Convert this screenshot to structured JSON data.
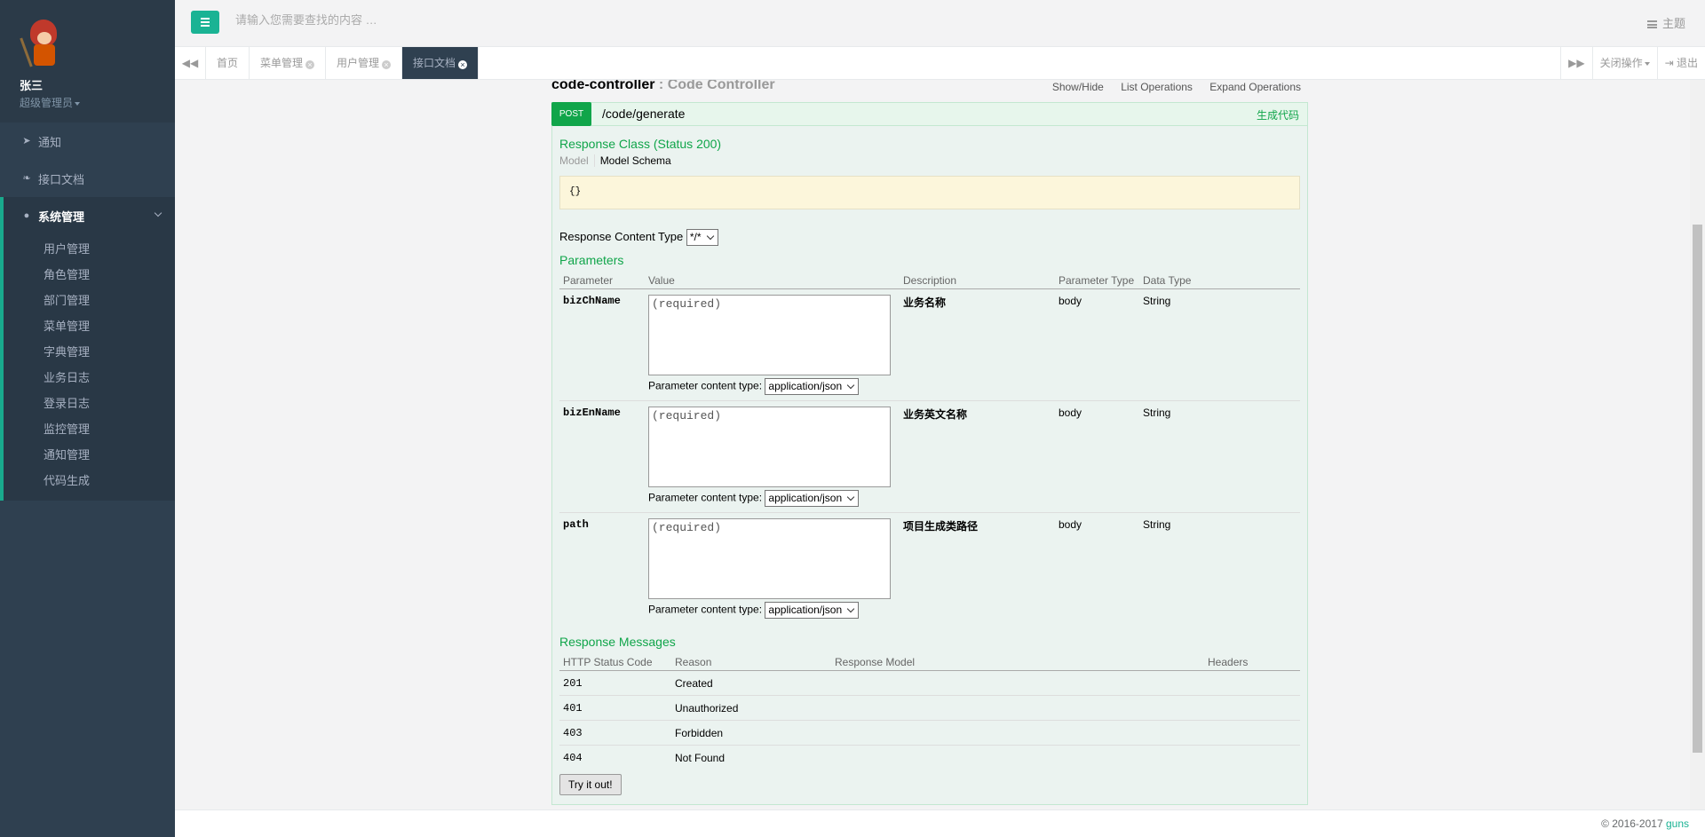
{
  "profile": {
    "name": "张三",
    "role": "超级管理员"
  },
  "nav": {
    "items": [
      {
        "label": "通知",
        "icon": "paper-plane-icon"
      },
      {
        "label": "接口文档",
        "icon": "leaf-icon"
      },
      {
        "label": "系统管理",
        "icon": "user-icon"
      }
    ],
    "sub_items": [
      "用户管理",
      "角色管理",
      "部门管理",
      "菜单管理",
      "字典管理",
      "业务日志",
      "登录日志",
      "监控管理",
      "通知管理",
      "代码生成"
    ]
  },
  "header": {
    "search_placeholder": "请输入您需要查找的内容 …",
    "theme_label": "主题"
  },
  "tabs": {
    "items": [
      "首页",
      "菜单管理",
      "用户管理",
      "接口文档"
    ],
    "active": "接口文档",
    "close_ops": "关闭操作",
    "logout": "退出"
  },
  "swagger": {
    "controller_name": "code-controller",
    "controller_sep": " : ",
    "controller_desc": "Code Controller",
    "links": [
      "Show/Hide",
      "List Operations",
      "Expand Operations"
    ],
    "op": {
      "method": "POST",
      "path": "/code/generate",
      "summary": "生成代码",
      "response_class_title": "Response Class (Status 200)",
      "model_tab": "Model",
      "schema_tab": "Model Schema",
      "model_value": "{}",
      "response_content_type_label": "Response Content Type",
      "response_content_type_value": "*/*",
      "parameters_title": "Parameters",
      "param_headers": [
        "Parameter",
        "Value",
        "Description",
        "Parameter Type",
        "Data Type"
      ],
      "params": [
        {
          "name": "bizChName",
          "placeholder": "(required)",
          "description": "业务名称",
          "ptype": "body",
          "dtype": "String",
          "content_type_label": "Parameter content type:",
          "content_type": "application/json"
        },
        {
          "name": "bizEnName",
          "placeholder": "(required)",
          "description": "业务英文名称",
          "ptype": "body",
          "dtype": "String",
          "content_type_label": "Parameter content type:",
          "content_type": "application/json"
        },
        {
          "name": "path",
          "placeholder": "(required)",
          "description": "项目生成类路径",
          "ptype": "body",
          "dtype": "String",
          "content_type_label": "Parameter content type:",
          "content_type": "application/json"
        }
      ],
      "response_messages_title": "Response Messages",
      "resp_headers": [
        "HTTP Status Code",
        "Reason",
        "Response Model",
        "Headers"
      ],
      "responses": [
        {
          "code": "201",
          "reason": "Created"
        },
        {
          "code": "401",
          "reason": "Unauthorized"
        },
        {
          "code": "403",
          "reason": "Forbidden"
        },
        {
          "code": "404",
          "reason": "Not Found"
        }
      ],
      "try_label": "Try it out!"
    }
  },
  "footer": {
    "copyright": "© 2016-2017 ",
    "brand": "guns"
  },
  "colors": {
    "accent": "#1ab394",
    "sidebar": "#2f4050",
    "post": "#10a54a"
  }
}
